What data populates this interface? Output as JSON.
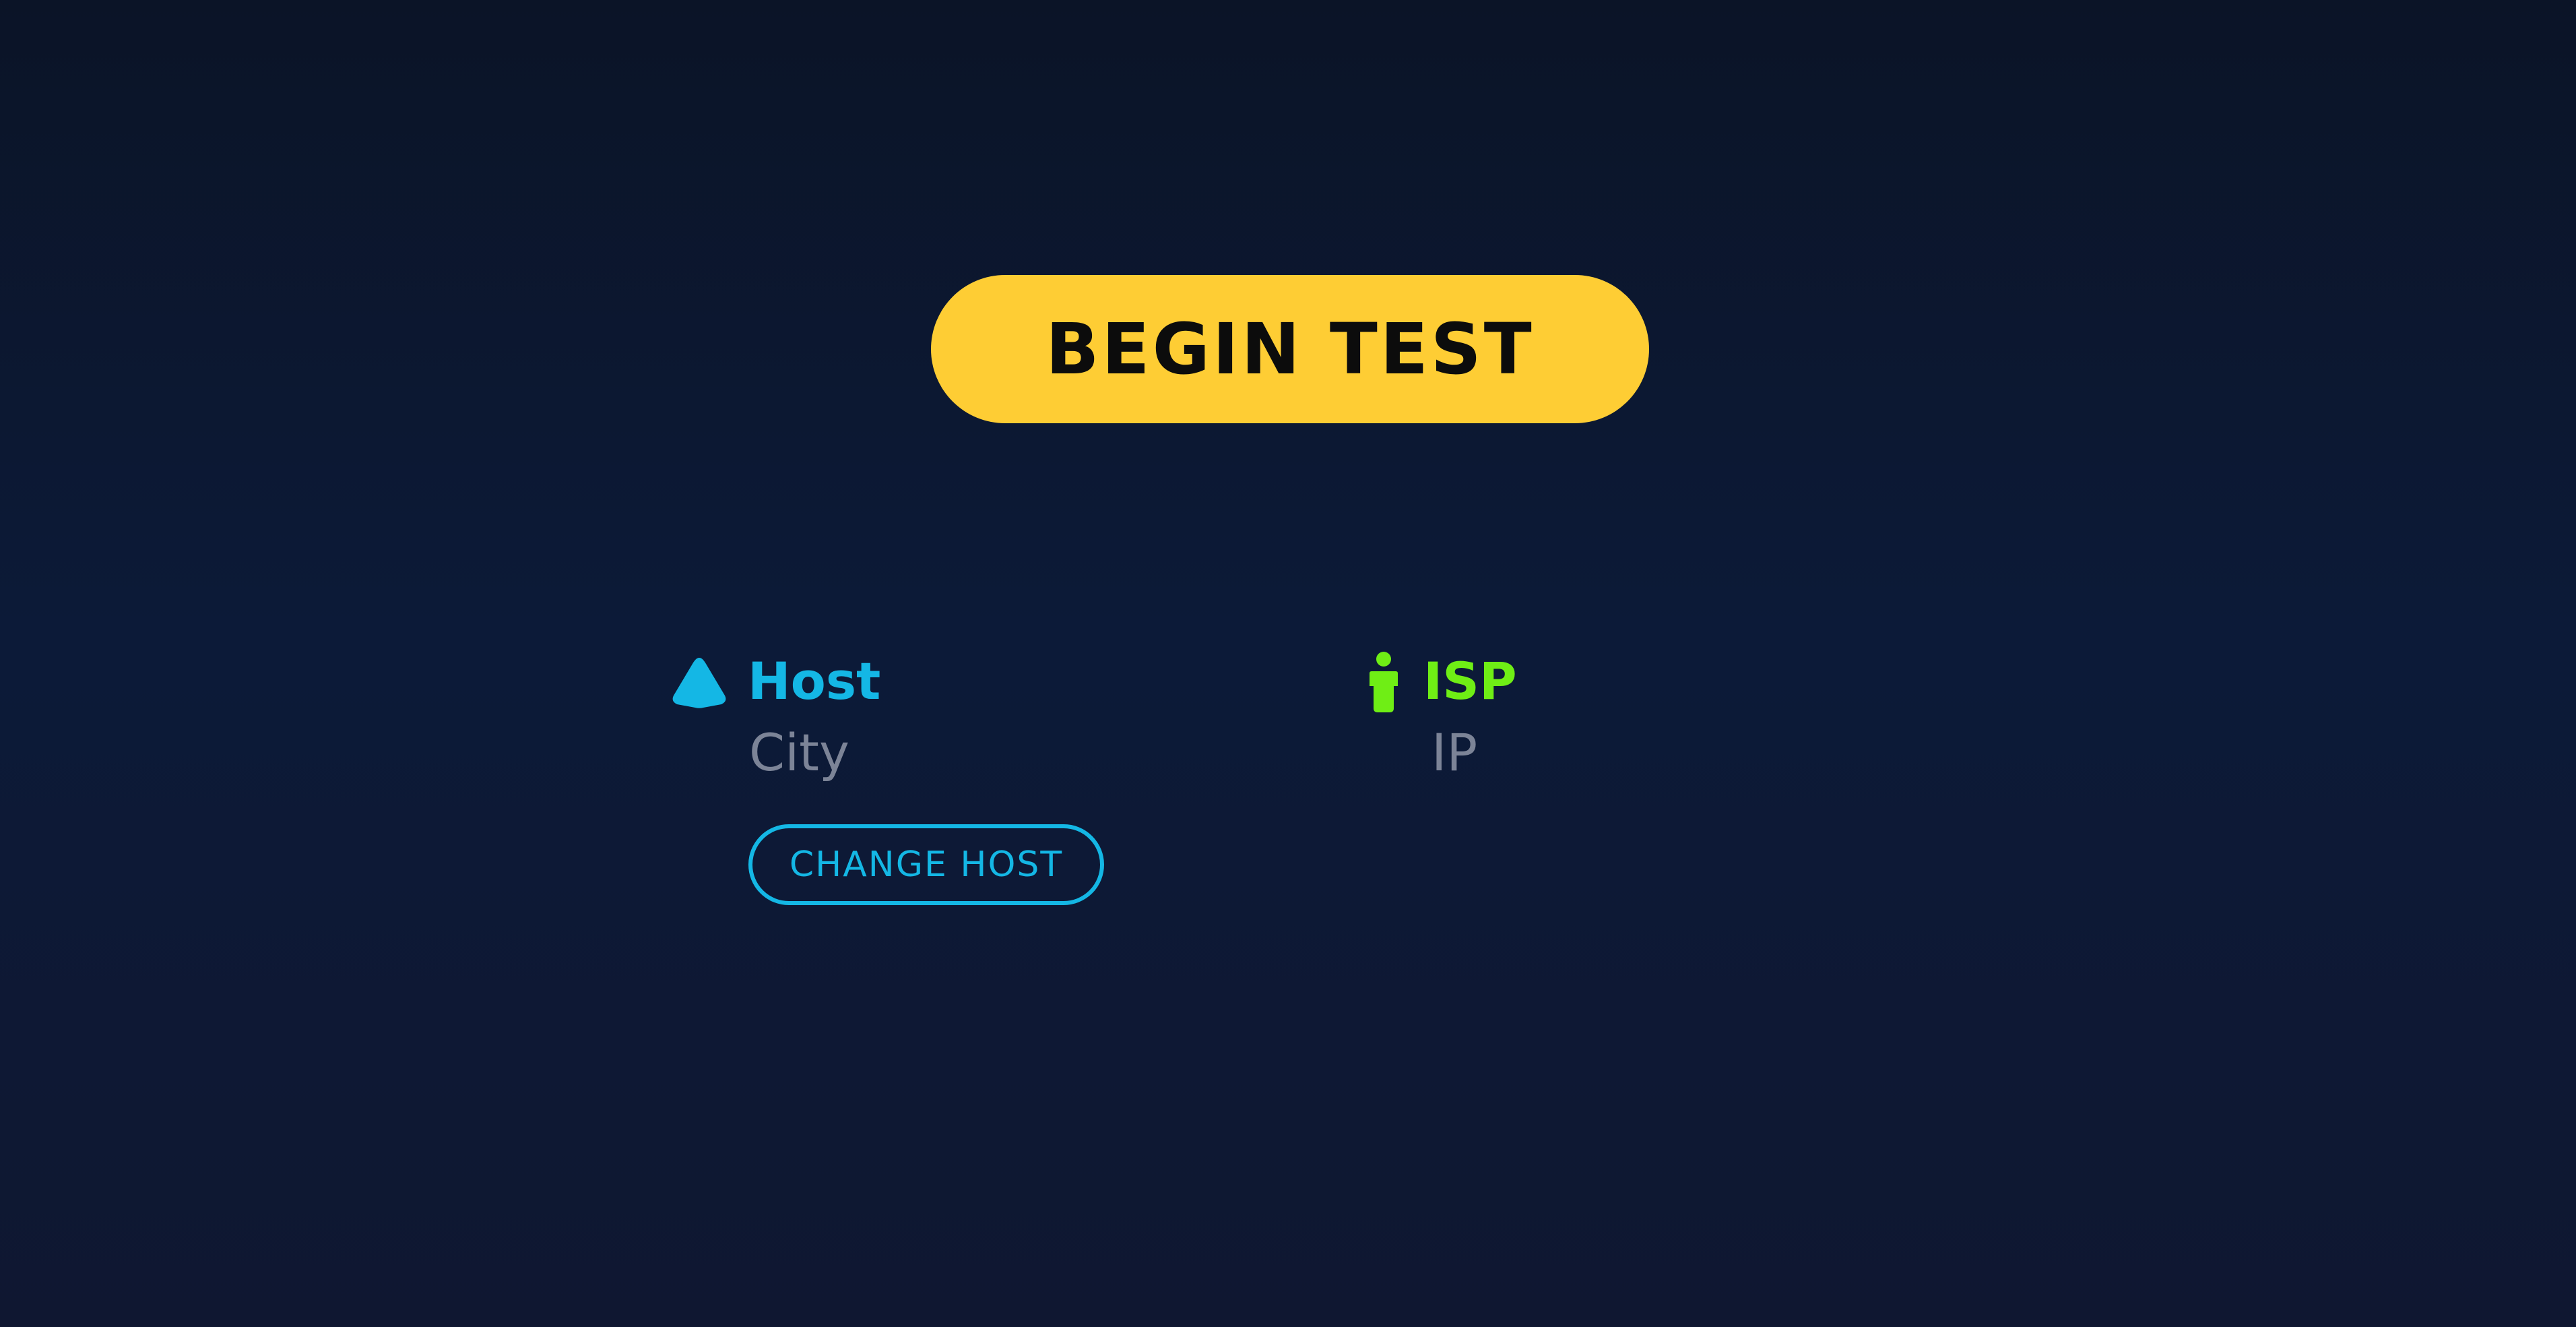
{
  "test": {
    "start_label": "BEGIN TEST"
  },
  "host": {
    "icon": "server-pyramid-icon",
    "title": "Host",
    "location": "City",
    "change_label": "CHANGE HOST"
  },
  "isp": {
    "icon": "person-icon",
    "title": "ISP",
    "address": "IP"
  },
  "colors": {
    "accent_yellow": "#fecd34",
    "host_blue": "#14b7e5",
    "isp_green": "#6fee15",
    "muted_text": "#7c8497",
    "background": "#0c1a38"
  }
}
